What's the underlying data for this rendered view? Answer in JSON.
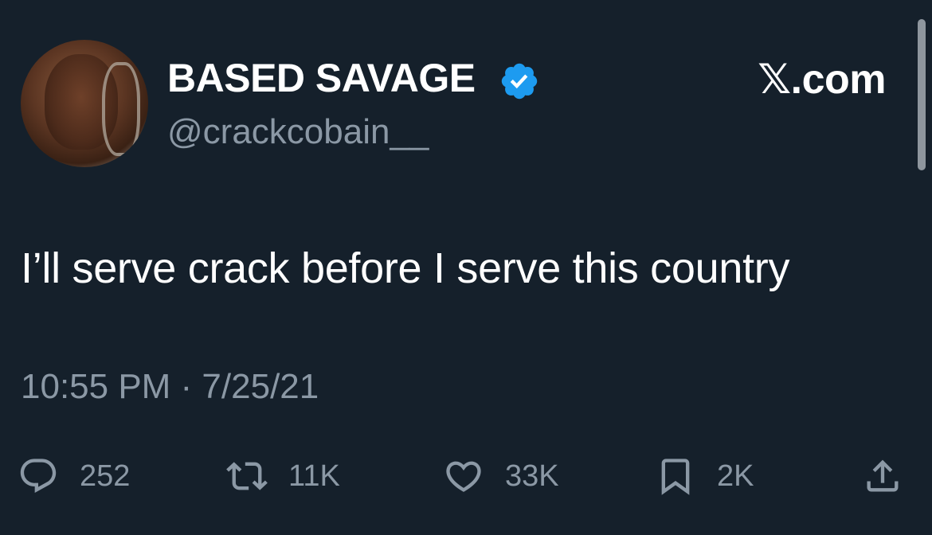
{
  "author": {
    "display_name": "BASED SAVAGE",
    "handle": "@crackcobain__",
    "verified": true,
    "avatar_icon": "profile-photo"
  },
  "brand": "𝕏.com",
  "tweet": {
    "text": "I’ll serve crack before I serve this country",
    "timestamp": "10:55 PM · 7/25/21"
  },
  "actions": {
    "replies": "252",
    "retweets": "11K",
    "likes": "33K",
    "bookmarks": "2K"
  },
  "colors": {
    "background": "#15202b",
    "text": "#ffffff",
    "secondary_text": "#8b98a5",
    "verified": "#1d9bf0"
  }
}
